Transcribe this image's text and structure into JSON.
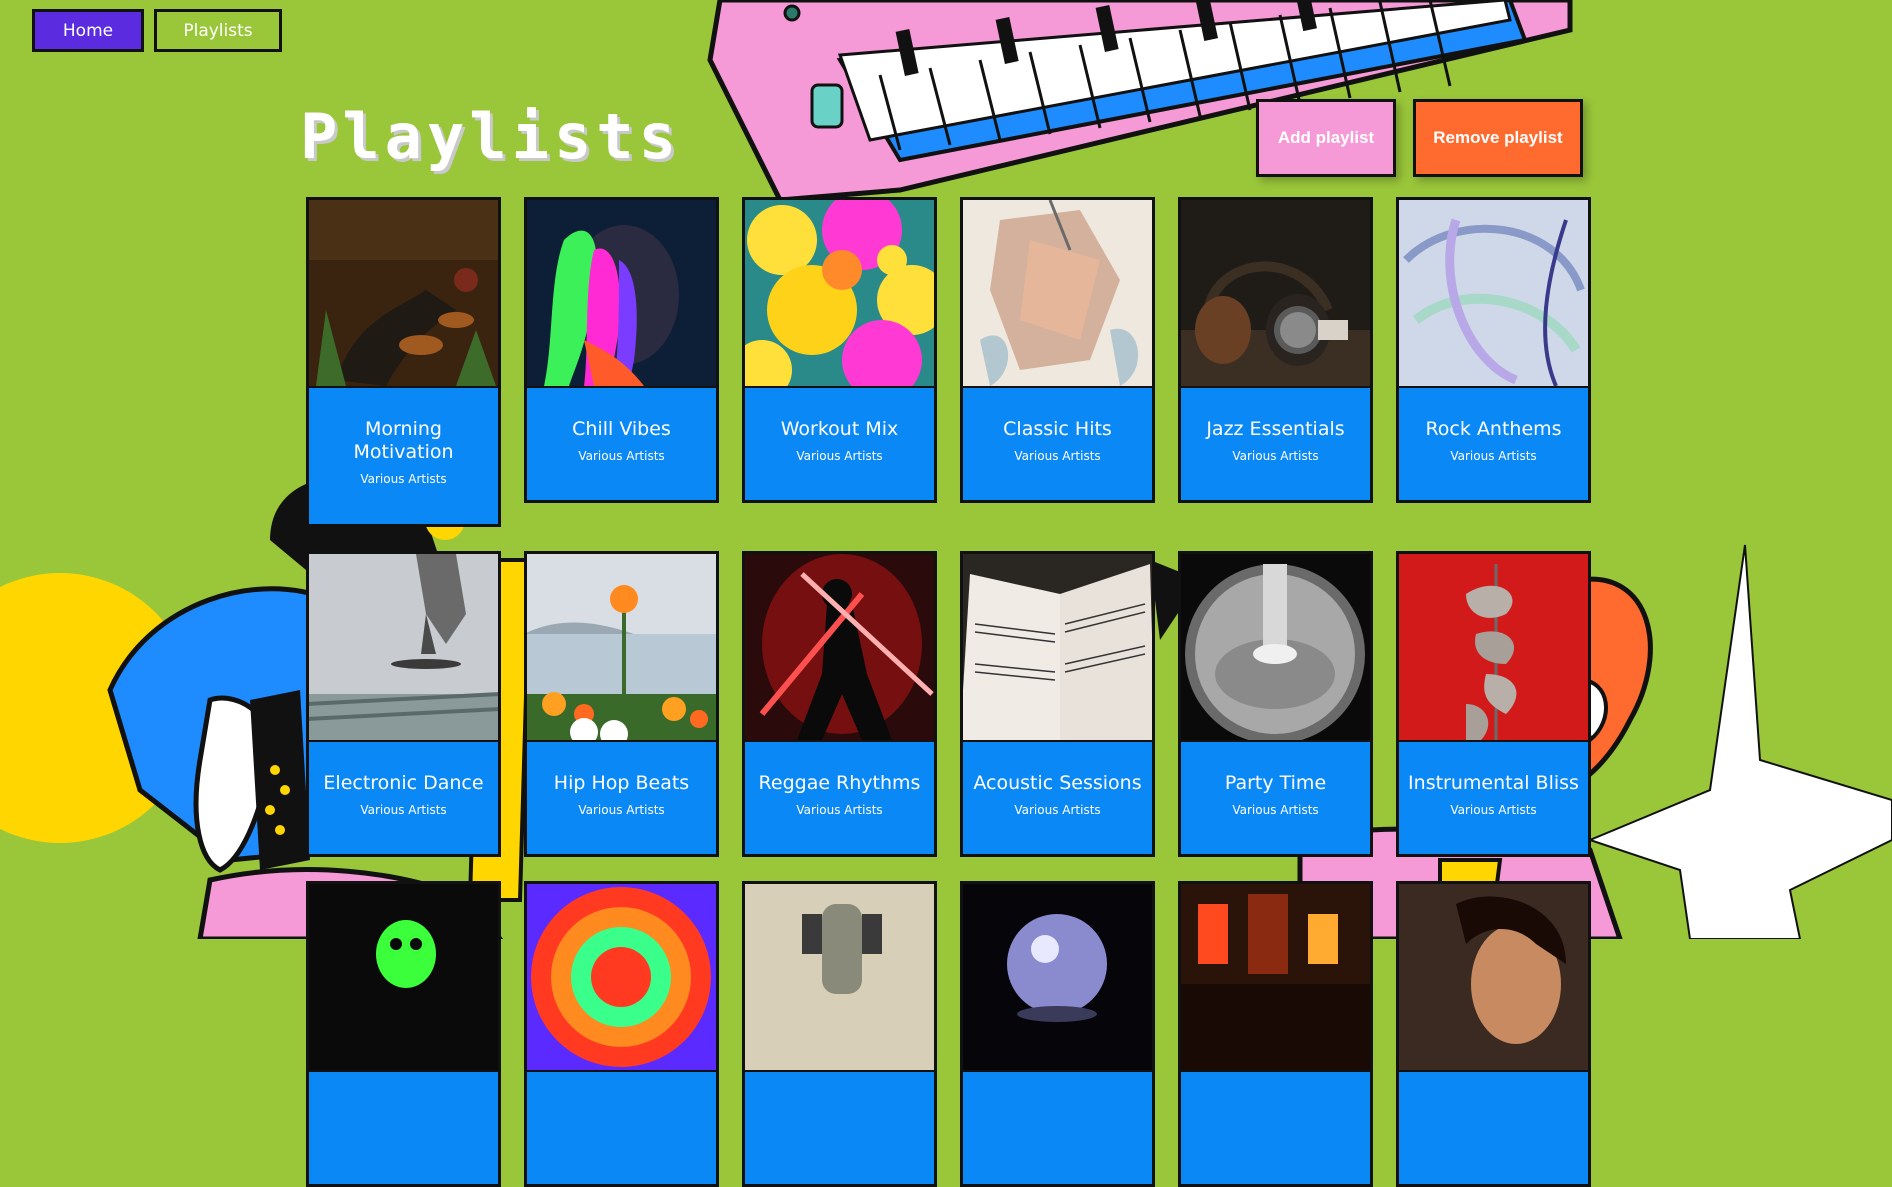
{
  "nav": {
    "home_label": "Home",
    "playlists_label": "Playlists"
  },
  "page": {
    "title": "Playlists",
    "add_label": "Add playlist",
    "remove_label": "Remove playlist"
  },
  "colors": {
    "background": "#9ac63a",
    "home_button": "#5b2be0",
    "card": "#0a88f5",
    "add_button": "#f59ad6",
    "remove_button": "#ff6a2e"
  },
  "playlists": [
    {
      "name": "Morning Motivation",
      "artist": "Various Artists",
      "cover": "plants-boots"
    },
    {
      "name": "Chill Vibes",
      "artist": "Various Artists",
      "cover": "neon-portrait"
    },
    {
      "name": "Workout Mix",
      "artist": "Various Artists",
      "cover": "yellow-pink-leaves"
    },
    {
      "name": "Classic Hits",
      "artist": "Various Artists",
      "cover": "abstract-glass"
    },
    {
      "name": "Jazz Essentials",
      "artist": "Various Artists",
      "cover": "headphones"
    },
    {
      "name": "Rock Anthems",
      "artist": "Various Artists",
      "cover": "glass-swirl"
    },
    {
      "name": "Electronic Dance",
      "artist": "Various Artists",
      "cover": "skateboarder"
    },
    {
      "name": "Hip Hop Beats",
      "artist": "Various Artists",
      "cover": "tulips-lake"
    },
    {
      "name": "Reggae Rhythms",
      "artist": "Various Artists",
      "cover": "red-lightsaber-dancer"
    },
    {
      "name": "Acoustic Sessions",
      "artist": "Various Artists",
      "cover": "sheet-music"
    },
    {
      "name": "Party Time",
      "artist": "Various Artists",
      "cover": "fisheye-lamp"
    },
    {
      "name": "Instrumental Bliss",
      "artist": "Various Artists",
      "cover": "red-sculpture"
    },
    {
      "name": "",
      "artist": "",
      "cover": "green-skull-dark"
    },
    {
      "name": "",
      "artist": "",
      "cover": "colorful-rings"
    },
    {
      "name": "",
      "artist": "",
      "cover": "vintage-microphone"
    },
    {
      "name": "",
      "artist": "",
      "cover": "glass-sphere"
    },
    {
      "name": "",
      "artist": "",
      "cover": "red-street"
    },
    {
      "name": "",
      "artist": "",
      "cover": "woman-portrait"
    }
  ]
}
